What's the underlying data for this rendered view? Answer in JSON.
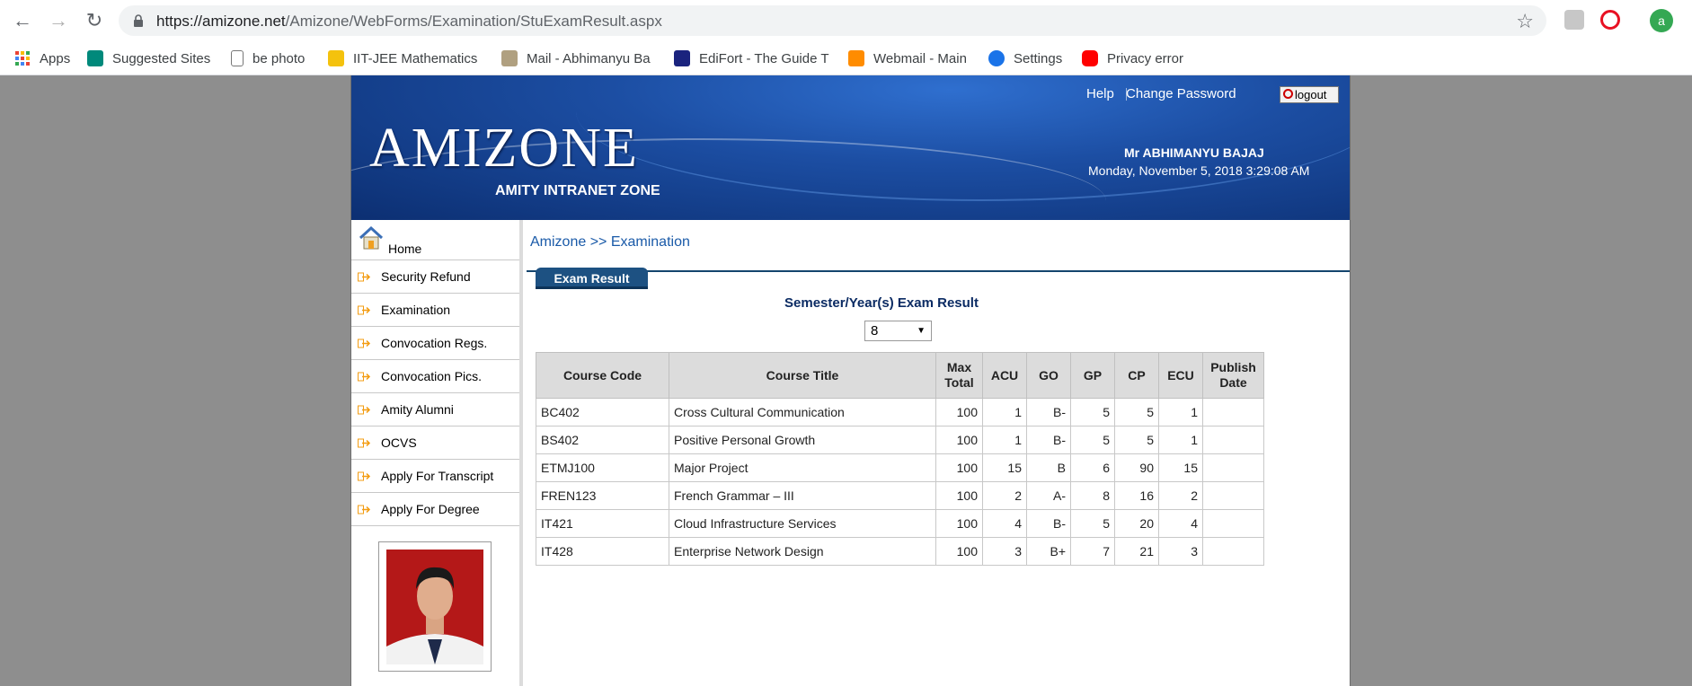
{
  "browser": {
    "url_host": "https://amizone.net",
    "url_path": "/Amizone/WebForms/Examination/StuExamResult.aspx",
    "profile_initial": "a",
    "bookmarks": [
      {
        "label": "Apps",
        "color": "#ea4335"
      },
      {
        "label": "Suggested Sites",
        "color": "#00897b"
      },
      {
        "label": "be photo",
        "color": "#9e9e9e"
      },
      {
        "label": "IIT-JEE Mathematics",
        "color": "#f4c20d"
      },
      {
        "label": "Mail - Abhimanyu Ba",
        "color": "#b0a080"
      },
      {
        "label": "EdiFort - The Guide T",
        "color": "#1a237e"
      },
      {
        "label": "Webmail - Main",
        "color": "#ff8c00"
      },
      {
        "label": "Settings",
        "color": "#1a73e8"
      },
      {
        "label": "Privacy error",
        "color": "#ff0000"
      }
    ]
  },
  "header": {
    "logo": "AMIZONE",
    "logo_subtitle": "AMITY INTRANET ZONE",
    "help": "Help",
    "change_password": "Change Password",
    "logout": "logout",
    "user_name": "Mr ABHIMANYU BAJAJ",
    "datetime": "Monday, November 5, 2018 3:29:08 AM"
  },
  "sidebar": {
    "home": "Home",
    "items": [
      "Security Refund",
      "Examination",
      "Convocation Regs.",
      "Convocation Pics.",
      "Amity Alumni",
      "OCVS",
      "Apply For Transcript",
      "Apply For Degree"
    ]
  },
  "main": {
    "breadcrumb": "Amizone >> Examination",
    "tab": "Exam Result",
    "section_title": "Semester/Year(s) Exam Result",
    "semester_selected": "8",
    "columns": [
      "Course Code",
      "Course Title",
      "Max Total",
      "ACU",
      "GO",
      "GP",
      "CP",
      "ECU",
      "Publish Date"
    ],
    "rows": [
      {
        "code": "BC402",
        "title": "Cross Cultural Communication",
        "max": "100",
        "acu": "1",
        "go": "B-",
        "gp": "5",
        "cp": "5",
        "ecu": "1",
        "date": ""
      },
      {
        "code": "BS402",
        "title": "Positive Personal Growth",
        "max": "100",
        "acu": "1",
        "go": "B-",
        "gp": "5",
        "cp": "5",
        "ecu": "1",
        "date": ""
      },
      {
        "code": "ETMJ100",
        "title": "Major Project",
        "max": "100",
        "acu": "15",
        "go": "B",
        "gp": "6",
        "cp": "90",
        "ecu": "15",
        "date": ""
      },
      {
        "code": "FREN123",
        "title": "French Grammar – III",
        "max": "100",
        "acu": "2",
        "go": "A-",
        "gp": "8",
        "cp": "16",
        "ecu": "2",
        "date": ""
      },
      {
        "code": "IT421",
        "title": "Cloud Infrastructure Services",
        "max": "100",
        "acu": "4",
        "go": "B-",
        "gp": "5",
        "cp": "20",
        "ecu": "4",
        "date": ""
      },
      {
        "code": "IT428",
        "title": "Enterprise Network Design",
        "max": "100",
        "acu": "3",
        "go": "B+",
        "gp": "7",
        "cp": "21",
        "ecu": "3",
        "date": ""
      }
    ]
  }
}
